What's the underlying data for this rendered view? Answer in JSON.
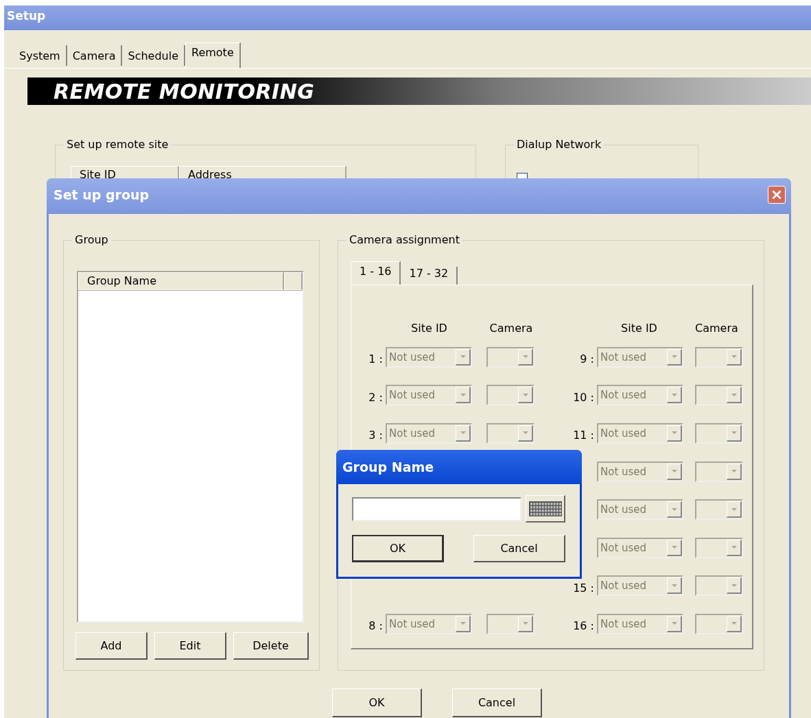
{
  "window": {
    "title": "Setup"
  },
  "tabs": [
    {
      "label": "System",
      "selected": false
    },
    {
      "label": "Camera",
      "selected": false
    },
    {
      "label": "Schedule",
      "selected": false
    },
    {
      "label": "Remote",
      "selected": true
    }
  ],
  "banner": {
    "title": "REMOTE MONITORING"
  },
  "remote_site": {
    "title": "Set up remote site",
    "columns": [
      "Site ID",
      "Address"
    ]
  },
  "dialup": {
    "title": "Dialup Network",
    "checkbox": {
      "checked": false
    }
  },
  "group_dialog": {
    "title": "Set up group",
    "group": {
      "title": "Group",
      "columns": [
        "Group Name"
      ],
      "buttons": [
        "Add",
        "Edit",
        "Delete"
      ]
    },
    "camera_assignment": {
      "title": "Camera assignment",
      "tabs": [
        {
          "label": "1 - 16",
          "selected": true
        },
        {
          "label": "17 - 32",
          "selected": false
        }
      ],
      "headers": [
        "Site ID",
        "Camera",
        "Site ID",
        "Camera"
      ],
      "rows": [
        {
          "left": {
            "number": "1 :",
            "site": "Not used",
            "disabled": true
          },
          "right": {
            "number": "9 :",
            "site": "Not used",
            "disabled": true
          }
        },
        {
          "left": {
            "number": "2 :",
            "site": "Not used",
            "disabled": true
          },
          "right": {
            "number": "10 :",
            "site": "Not used",
            "disabled": true
          }
        },
        {
          "left": {
            "number": "3 :",
            "site": "Not used",
            "disabled": true
          },
          "right": {
            "number": "11 :",
            "site": "Not used",
            "disabled": true
          }
        },
        {
          "left": null,
          "right": {
            "site": "Not used",
            "disabled": true
          }
        },
        {
          "left": null,
          "right": {
            "site": "Not used",
            "disabled": true
          }
        },
        {
          "left": null,
          "right": {
            "site": "Not used",
            "disabled": true
          }
        },
        {
          "left": null,
          "right": {
            "number": "15 :",
            "site": "Not used",
            "disabled": true
          }
        },
        {
          "left": {
            "number": "8 :",
            "site": "Not used",
            "disabled": true
          },
          "right": {
            "number": "16 :",
            "site": "Not used",
            "disabled": true
          }
        }
      ]
    },
    "buttons": [
      "OK",
      "Cancel"
    ]
  },
  "name_dialog": {
    "title": "Group Name",
    "buttons": [
      {
        "label": "OK",
        "default": true
      },
      {
        "label": "Cancel",
        "default": false
      }
    ]
  }
}
